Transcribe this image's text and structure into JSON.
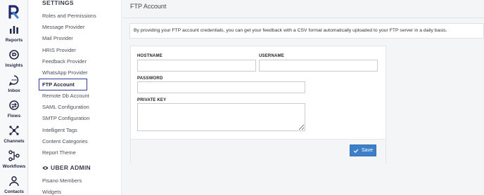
{
  "rail": {
    "items": [
      {
        "label": "Reports",
        "icon": "reports-icon"
      },
      {
        "label": "Insights",
        "icon": "insights-icon"
      },
      {
        "label": "Inbox",
        "icon": "inbox-icon"
      },
      {
        "label": "Flows",
        "icon": "flows-icon"
      },
      {
        "label": "Channels",
        "icon": "channels-icon"
      },
      {
        "label": "Workflows",
        "icon": "workflows-icon"
      },
      {
        "label": "Contacts",
        "icon": "contacts-icon"
      }
    ]
  },
  "settings": {
    "section_title": "SETTINGS",
    "items": [
      "Roles and Permissions",
      "Message Provider",
      "Mail Provider",
      "HRIS Provider",
      "Feedback Provider",
      "WhatsApp Provider",
      "FTP Account",
      "Remote Db Account",
      "SAML Configuration",
      "SMTP Configuration",
      "Intelligent Tags",
      "Content Categories",
      "Report Theme"
    ],
    "active_item": "FTP Account",
    "admin_title": "UBER ADMIN",
    "admin_items": [
      "Pisano Members",
      "Widgets"
    ]
  },
  "main": {
    "title": "FTP Account",
    "notice": "By providing your FTP account credentials, you can get your feedback with a CSV format automatically uploaded to your FTP server in a daily basis.",
    "form": {
      "hostname_label": "HOSTNAME",
      "hostname_value": "",
      "username_label": "USERNAME",
      "username_value": "",
      "password_label": "PASSWORD",
      "password_value": "",
      "private_key_label": "PRIVATE KEY",
      "private_key_value": ""
    },
    "save_label": "Save"
  },
  "colors": {
    "accent": "#3d7fc9",
    "active_border": "#2f3b95",
    "rail_text": "#1f2540"
  }
}
